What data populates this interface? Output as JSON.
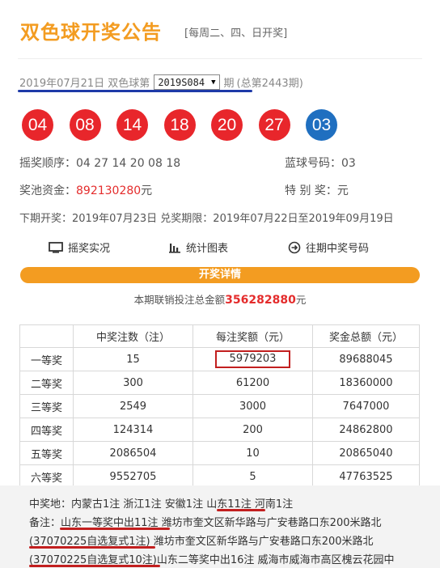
{
  "header": {
    "title": "双色球开奖公告",
    "schedule": "[每周二、四、日开奖]"
  },
  "issue": {
    "prefix": "2019年07月21日 双色球第",
    "selected": "2019S084",
    "suffix": "期",
    "total": "(总第2443期)"
  },
  "balls": {
    "red": [
      "04",
      "08",
      "14",
      "18",
      "20",
      "27"
    ],
    "blue": "03"
  },
  "info": {
    "order_label": "摇奖顺序：04 27 14 20 08 18",
    "blue_label": "蓝球号码：03",
    "pool_label": "奖池资金：",
    "pool_value": "892130280",
    "pool_unit": "元",
    "special_label": "特 别 奖：元",
    "next_draw": "下期开奖：2019年07月23日 兑奖期限：2019年07月22日至2019年09月19日"
  },
  "links": {
    "live": "摇奖实况",
    "chart": "统计图表",
    "history": "往期中奖号码"
  },
  "detail_button": "开奖详情",
  "sales": {
    "prefix": "本期联销投注总金额",
    "value": "356282880",
    "unit": "元"
  },
  "table": {
    "headers": [
      "",
      "中奖注数（注）",
      "每注奖额（元）",
      "奖金总额（元）"
    ],
    "rows": [
      [
        "一等奖",
        "15",
        "5979203",
        "89688045"
      ],
      [
        "二等奖",
        "300",
        "61200",
        "18360000"
      ],
      [
        "三等奖",
        "2549",
        "3000",
        "7647000"
      ],
      [
        "四等奖",
        "124314",
        "200",
        "24862800"
      ],
      [
        "五等奖",
        "2086504",
        "10",
        "20865040"
      ],
      [
        "六等奖",
        "9552705",
        "5",
        "47763525"
      ]
    ]
  },
  "notes": {
    "line1": "中奖地：内蒙古1注 浙江1注 安徽1注 山东11注 河南1注",
    "line2": "备注：山东一等奖中出11注 潍坊市奎文区新华路与广安巷路口东200米路北",
    "line3": "(37070225自选复式1注) 潍坊市奎文区新华路与广安巷路口东200米路北",
    "line4": "(37070225自选复式10注)山东二等奖中出16注 威海市威海市高区槐云花园中"
  },
  "colors": {
    "accent": "#f39c21",
    "red_ball": "#e8262b",
    "blue_ball": "#1f6fc0",
    "annotation_red": "#c21f1f",
    "annotation_blue": "#1e3aa8"
  }
}
